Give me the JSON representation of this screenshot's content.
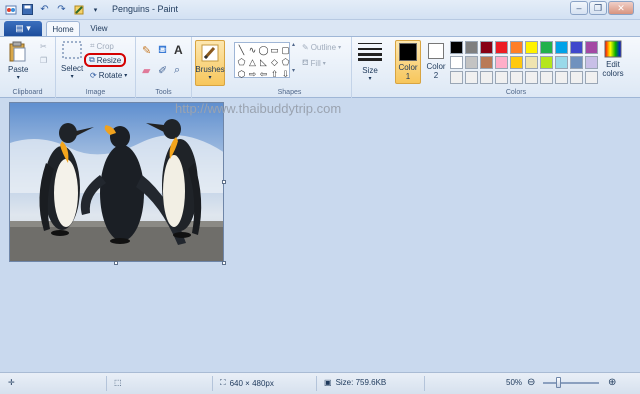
{
  "window": {
    "title": "Penguins - Paint"
  },
  "tabs": {
    "home": "Home",
    "view": "View"
  },
  "clipboard": {
    "paste": "Paste",
    "group": "Clipboard"
  },
  "image": {
    "select": "Select",
    "crop": "Crop",
    "resize": "Resize",
    "rotate": "Rotate",
    "group": "Image"
  },
  "tools": {
    "group": "Tools"
  },
  "brushes": {
    "label": "Brushes"
  },
  "shapes": {
    "outline": "Outline",
    "fill": "Fill",
    "group": "Shapes"
  },
  "size": {
    "label": "Size"
  },
  "colors": {
    "color1_label": "Color 1",
    "color2_label": "Color 2",
    "edit_label": "Edit colors",
    "group": "Colors",
    "color1": "#000000",
    "color2": "#ffffff",
    "palette_row1": [
      "#000000",
      "#7f7f7f",
      "#880015",
      "#ed1c24",
      "#ff7f27",
      "#fff200",
      "#22b14c",
      "#00a2e8",
      "#3f48cc",
      "#a349a4"
    ],
    "palette_row2": [
      "#ffffff",
      "#c3c3c3",
      "#b97a57",
      "#ffaec9",
      "#ffc90e",
      "#efe4b0",
      "#b5e61d",
      "#99d9ea",
      "#7092be",
      "#c8bfe7"
    ],
    "palette_row3": [
      "#f0f0f0",
      "#f0f0f0",
      "#f0f0f0",
      "#f0f0f0",
      "#f0f0f0",
      "#f0f0f0",
      "#f0f0f0",
      "#f0f0f0",
      "#f0f0f0",
      "#f0f0f0"
    ]
  },
  "watermark": "http://www.thaibuddytrip.com",
  "status": {
    "dimensions": "640 × 480px",
    "size": "Size: 759.6KB",
    "zoom": "50%"
  }
}
